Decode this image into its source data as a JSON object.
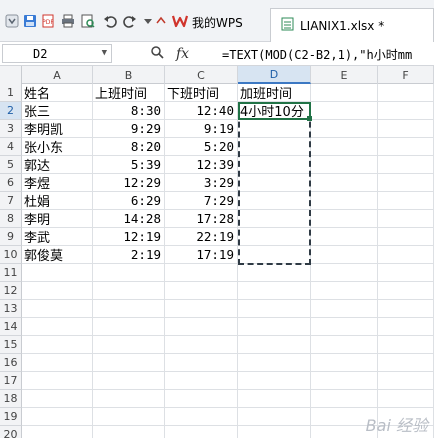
{
  "toolbar": {
    "icons": [
      "wps-logo-icon",
      "save-icon",
      "pdf-icon",
      "print-icon",
      "print-preview-icon",
      "undo-icon",
      "redo-icon",
      "dropdown-icon"
    ],
    "wps_tab_label": "我的WPS",
    "file_tab_label": "LIANIX1.xlsx *"
  },
  "formula_bar": {
    "name_box": "D2",
    "fx_label": "fx",
    "formula": "=TEXT(MOD(C2-B2,1),\"h小时mm"
  },
  "grid": {
    "columns": [
      "A",
      "B",
      "C",
      "D",
      "E",
      "F"
    ],
    "active_column": "D",
    "active_row": "2",
    "rows": [
      {
        "num": "1",
        "a": "姓名",
        "b": "上班时间",
        "c": "下班时间",
        "d": "加班时间"
      },
      {
        "num": "2",
        "a": "张三",
        "b": "8:30",
        "c": "12:40",
        "d": "4小时10分"
      },
      {
        "num": "3",
        "a": "李明凯",
        "b": "9:29",
        "c": "9:19",
        "d": ""
      },
      {
        "num": "4",
        "a": "张小东",
        "b": "8:20",
        "c": "5:20",
        "d": ""
      },
      {
        "num": "5",
        "a": "郭达",
        "b": "5:39",
        "c": "12:39",
        "d": ""
      },
      {
        "num": "6",
        "a": "李煜",
        "b": "12:29",
        "c": "3:29",
        "d": ""
      },
      {
        "num": "7",
        "a": "杜娟",
        "b": "6:29",
        "c": "7:29",
        "d": ""
      },
      {
        "num": "8",
        "a": "李明",
        "b": "14:28",
        "c": "17:28",
        "d": ""
      },
      {
        "num": "9",
        "a": "李武",
        "b": "12:19",
        "c": "22:19",
        "d": ""
      },
      {
        "num": "10",
        "a": "郭俊莫",
        "b": "2:19",
        "c": "17:19",
        "d": ""
      },
      {
        "num": "11",
        "a": "",
        "b": "",
        "c": "",
        "d": ""
      },
      {
        "num": "12",
        "a": "",
        "b": "",
        "c": "",
        "d": ""
      },
      {
        "num": "13",
        "a": "",
        "b": "",
        "c": "",
        "d": ""
      },
      {
        "num": "14",
        "a": "",
        "b": "",
        "c": "",
        "d": ""
      },
      {
        "num": "15",
        "a": "",
        "b": "",
        "c": "",
        "d": ""
      },
      {
        "num": "16",
        "a": "",
        "b": "",
        "c": "",
        "d": ""
      },
      {
        "num": "17",
        "a": "",
        "b": "",
        "c": "",
        "d": ""
      },
      {
        "num": "18",
        "a": "",
        "b": "",
        "c": "",
        "d": ""
      },
      {
        "num": "19",
        "a": "",
        "b": "",
        "c": "",
        "d": ""
      },
      {
        "num": "20",
        "a": "",
        "b": "",
        "c": "",
        "d": ""
      }
    ]
  },
  "colors": {
    "accent_green": "#217346",
    "header_bg": "#f2f3f5",
    "active_header_bg": "#d7e4f2"
  }
}
